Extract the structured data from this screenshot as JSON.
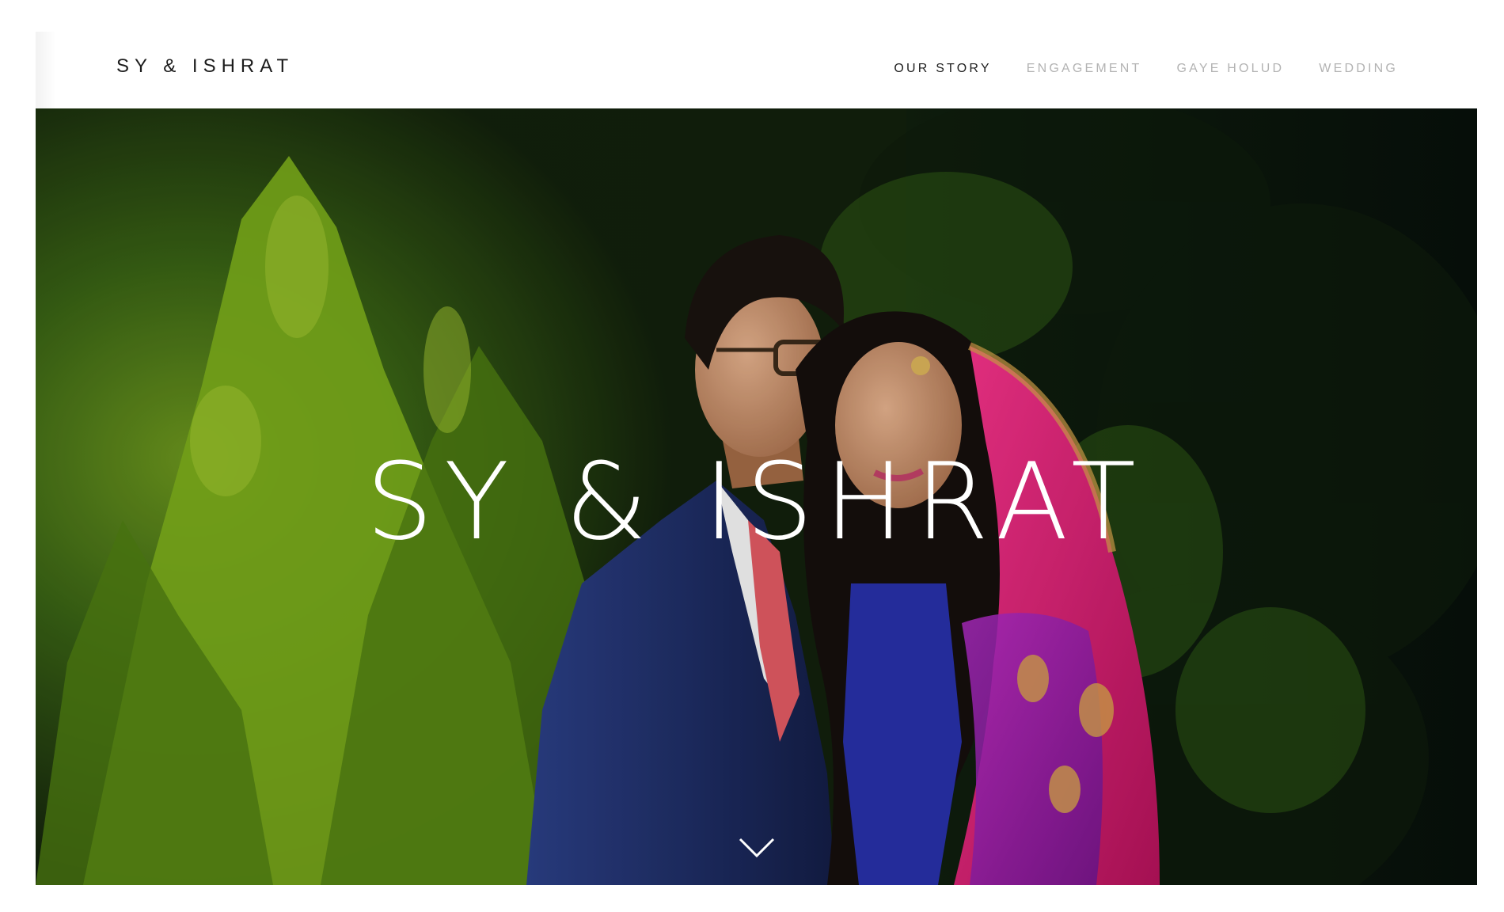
{
  "site": {
    "logo": "SY & ISHRAT"
  },
  "nav": {
    "items": [
      {
        "label": "OUR STORY",
        "active": true
      },
      {
        "label": "ENGAGEMENT",
        "active": false
      },
      {
        "label": "GAYE HOLUD",
        "active": false
      },
      {
        "label": "WEDDING",
        "active": false
      }
    ]
  },
  "hero": {
    "title": "SY & ISHRAT",
    "scroll_icon": "chevron-down-icon",
    "photo_subject": "couple-portrait-image"
  },
  "colors": {
    "nav_active": "#1f1f1f",
    "nav_inactive": "#b3b3b3",
    "hero_text": "#ffffff",
    "foliage_dark": "#13240f",
    "suit_blue": "#1f2f66",
    "dupatta_pink": "#e0246e"
  }
}
